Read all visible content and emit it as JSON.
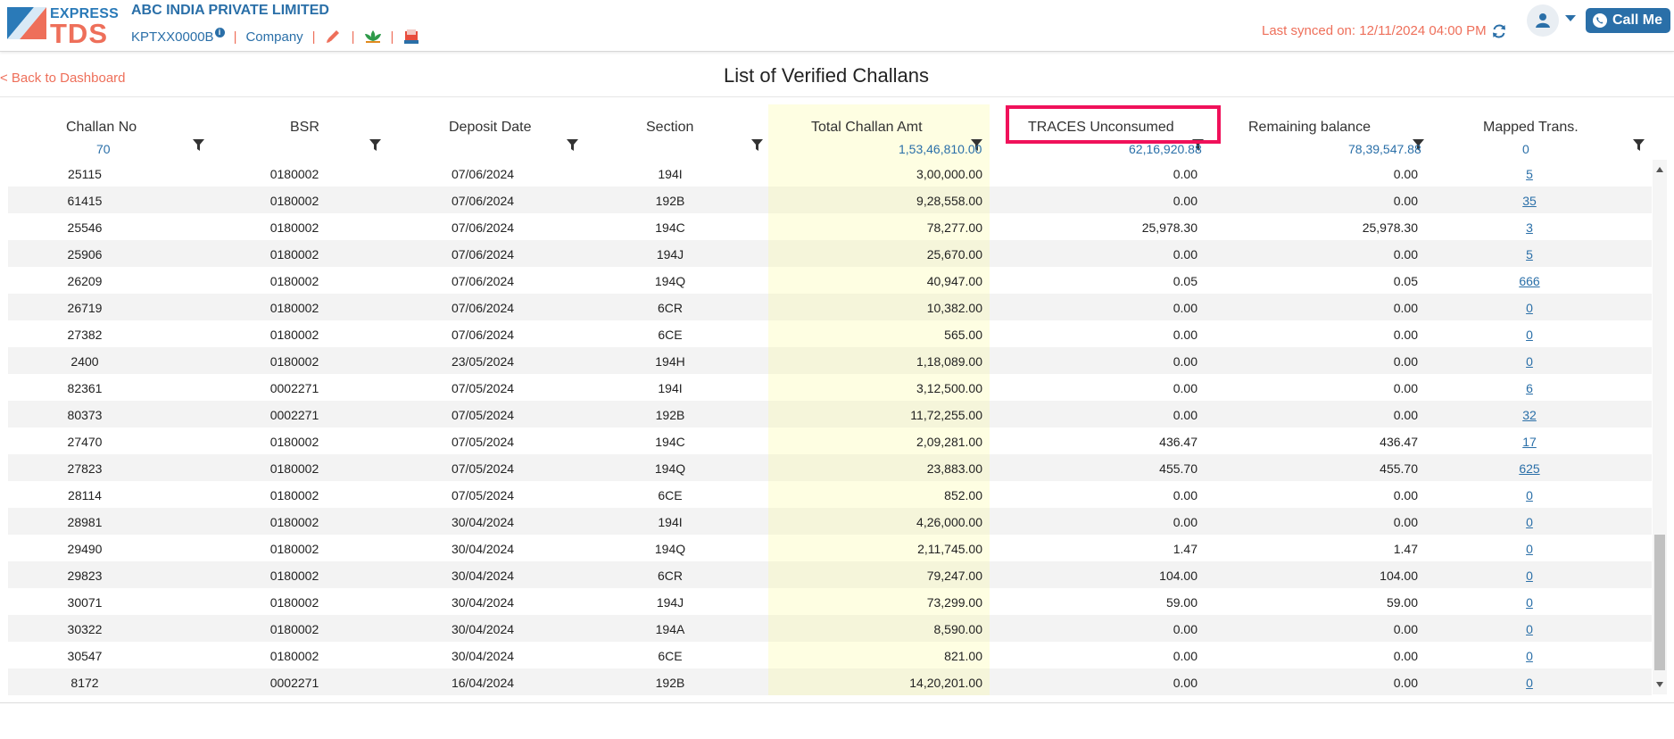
{
  "header": {
    "logo_line1": "EXPRESS",
    "logo_line2": "TDS",
    "company_name": "ABC INDIA PRIVATE LIMITED",
    "tan": "KPTXX0000B",
    "company_label": "Company",
    "separator": "|",
    "last_synced": "Last synced on: 12/11/2024 04:00 PM",
    "call_me_label": "Call Me",
    "brand_color": "#2a6fa8",
    "accent_color": "#ee6f5a"
  },
  "page": {
    "back_link": "< Back to Dashboard",
    "title": "List of Verified Challans"
  },
  "table": {
    "columns": [
      {
        "key": "challan_no",
        "label": "Challan No",
        "total": "70"
      },
      {
        "key": "bsr",
        "label": "BSR",
        "total": ""
      },
      {
        "key": "deposit_date",
        "label": "Deposit Date",
        "total": ""
      },
      {
        "key": "section",
        "label": "Section",
        "total": ""
      },
      {
        "key": "total_amt",
        "label": "Total Challan Amt",
        "total": "1,53,46,810.00"
      },
      {
        "key": "traces",
        "label": "TRACES Unconsumed",
        "total": "62,16,920.88"
      },
      {
        "key": "remaining",
        "label": "Remaining balance",
        "total": "78,39,547.88"
      },
      {
        "key": "mapped",
        "label": "Mapped Trans.",
        "total": "0"
      }
    ],
    "highlighted_column": "total_amt",
    "boxed_column": "traces",
    "box_color": "#f0115a",
    "rows": [
      [
        "25115",
        "0180002",
        "07/06/2024",
        "194I",
        "3,00,000.00",
        "0.00",
        "0.00",
        "5"
      ],
      [
        "61415",
        "0180002",
        "07/06/2024",
        "192B",
        "9,28,558.00",
        "0.00",
        "0.00",
        "35"
      ],
      [
        "25546",
        "0180002",
        "07/06/2024",
        "194C",
        "78,277.00",
        "25,978.30",
        "25,978.30",
        "3"
      ],
      [
        "25906",
        "0180002",
        "07/06/2024",
        "194J",
        "25,670.00",
        "0.00",
        "0.00",
        "5"
      ],
      [
        "26209",
        "0180002",
        "07/06/2024",
        "194Q",
        "40,947.00",
        "0.05",
        "0.05",
        "666"
      ],
      [
        "26719",
        "0180002",
        "07/06/2024",
        "6CR",
        "10,382.00",
        "0.00",
        "0.00",
        "0"
      ],
      [
        "27382",
        "0180002",
        "07/06/2024",
        "6CE",
        "565.00",
        "0.00",
        "0.00",
        "0"
      ],
      [
        "2400",
        "0180002",
        "23/05/2024",
        "194H",
        "1,18,089.00",
        "0.00",
        "0.00",
        "0"
      ],
      [
        "82361",
        "0002271",
        "07/05/2024",
        "194I",
        "3,12,500.00",
        "0.00",
        "0.00",
        "6"
      ],
      [
        "80373",
        "0002271",
        "07/05/2024",
        "192B",
        "11,72,255.00",
        "0.00",
        "0.00",
        "32"
      ],
      [
        "27470",
        "0180002",
        "07/05/2024",
        "194C",
        "2,09,281.00",
        "436.47",
        "436.47",
        "17"
      ],
      [
        "27823",
        "0180002",
        "07/05/2024",
        "194Q",
        "23,883.00",
        "455.70",
        "455.70",
        "625"
      ],
      [
        "28114",
        "0180002",
        "07/05/2024",
        "6CE",
        "852.00",
        "0.00",
        "0.00",
        "0"
      ],
      [
        "28981",
        "0180002",
        "30/04/2024",
        "194I",
        "4,26,000.00",
        "0.00",
        "0.00",
        "0"
      ],
      [
        "29490",
        "0180002",
        "30/04/2024",
        "194Q",
        "2,11,745.00",
        "1.47",
        "1.47",
        "0"
      ],
      [
        "29823",
        "0180002",
        "30/04/2024",
        "6CR",
        "79,247.00",
        "104.00",
        "104.00",
        "0"
      ],
      [
        "30071",
        "0180002",
        "30/04/2024",
        "194J",
        "73,299.00",
        "59.00",
        "59.00",
        "0"
      ],
      [
        "30322",
        "0180002",
        "30/04/2024",
        "194A",
        "8,590.00",
        "0.00",
        "0.00",
        "0"
      ],
      [
        "30547",
        "0180002",
        "30/04/2024",
        "6CE",
        "821.00",
        "0.00",
        "0.00",
        "0"
      ],
      [
        "8172",
        "0002271",
        "16/04/2024",
        "192B",
        "14,20,201.00",
        "0.00",
        "0.00",
        "0"
      ]
    ]
  }
}
